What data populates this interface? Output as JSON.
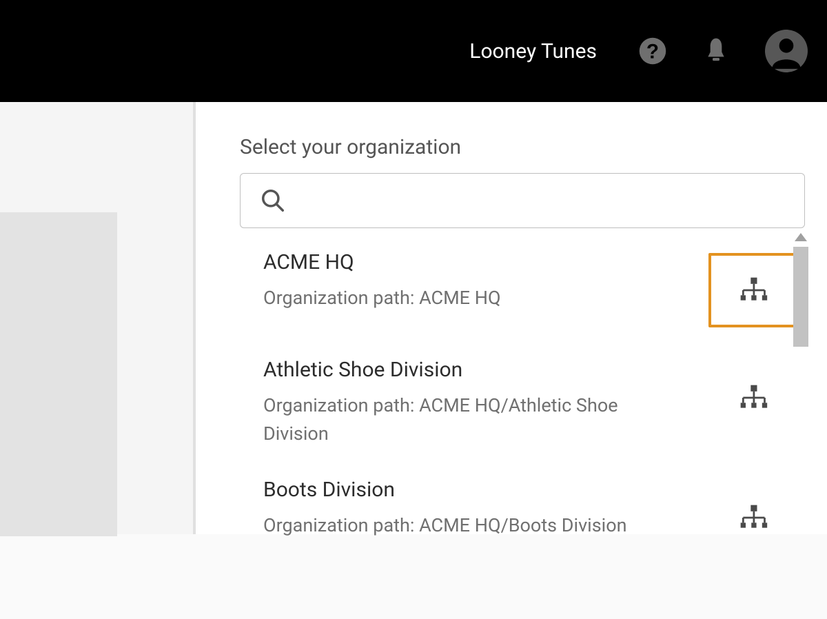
{
  "header": {
    "context": "Looney Tunes"
  },
  "main": {
    "title": "Select your organization",
    "search": {
      "placeholder": ""
    },
    "orgs": [
      {
        "name": "ACME HQ",
        "path": "Organization path: ACME HQ",
        "highlighted": true
      },
      {
        "name": "Athletic Shoe Division",
        "path": "Organization path: ACME HQ/Athletic Shoe Division",
        "highlighted": false
      },
      {
        "name": "Boots Division",
        "path": "Organization path: ACME HQ/Boots Division",
        "highlighted": false
      }
    ]
  }
}
